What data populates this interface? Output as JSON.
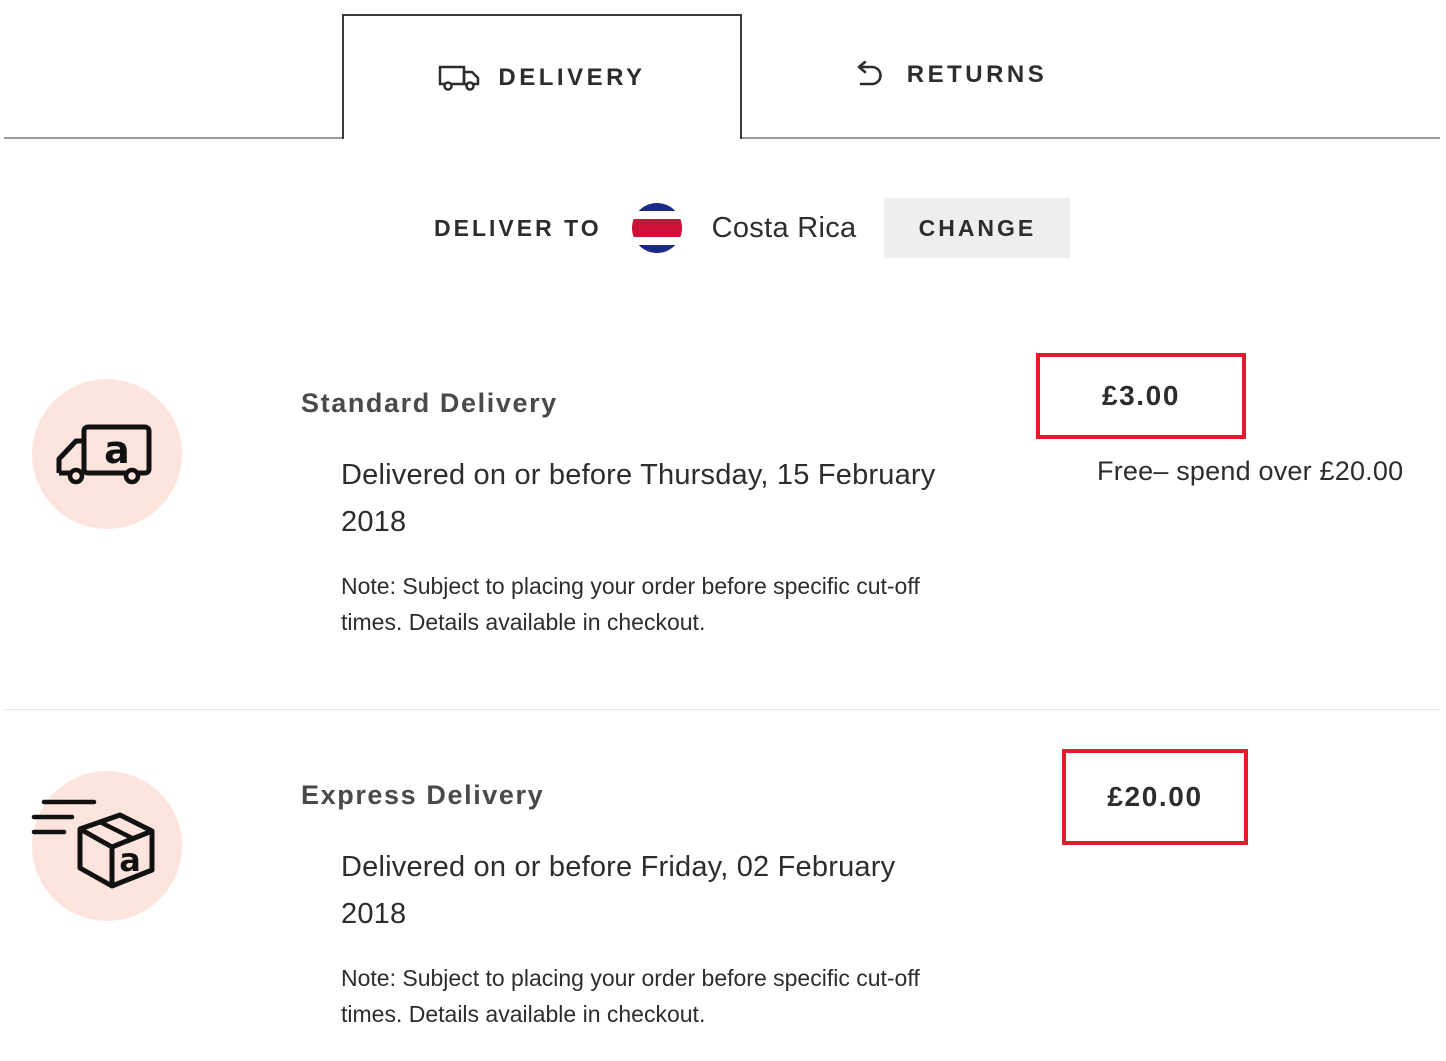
{
  "tabs": [
    {
      "label": "DELIVERY",
      "icon": "truck-icon",
      "active": true
    },
    {
      "label": "RETURNS",
      "icon": "return-arrow-icon",
      "active": false
    }
  ],
  "deliver_to": {
    "label": "DELIVER TO",
    "country": "Costa Rica",
    "flag_icon": "costa-rica-flag-icon",
    "change_label": "CHANGE"
  },
  "options": [
    {
      "title": "Standard Delivery",
      "icon": "delivery-truck-icon",
      "date": "Delivered on or before Thursday, 15 February 2018",
      "note": "Note: Subject to placing your order before specific cut-off times. Details available in checkout.",
      "price": "£3.00",
      "price_note": "Free– spend over £20.00"
    },
    {
      "title": "Express Delivery",
      "icon": "express-parcel-icon",
      "date": "Delivered on or before Friday, 02 February 2018",
      "note": "Note: Subject to placing your order before specific cut-off times. Details available in checkout.",
      "price": "£20.00"
    }
  ],
  "colors": {
    "highlight_border": "#e21b2c",
    "icon_circle": "#fde5dd",
    "change_button_bg": "#eeeeee",
    "text": "#2d2d2d"
  }
}
